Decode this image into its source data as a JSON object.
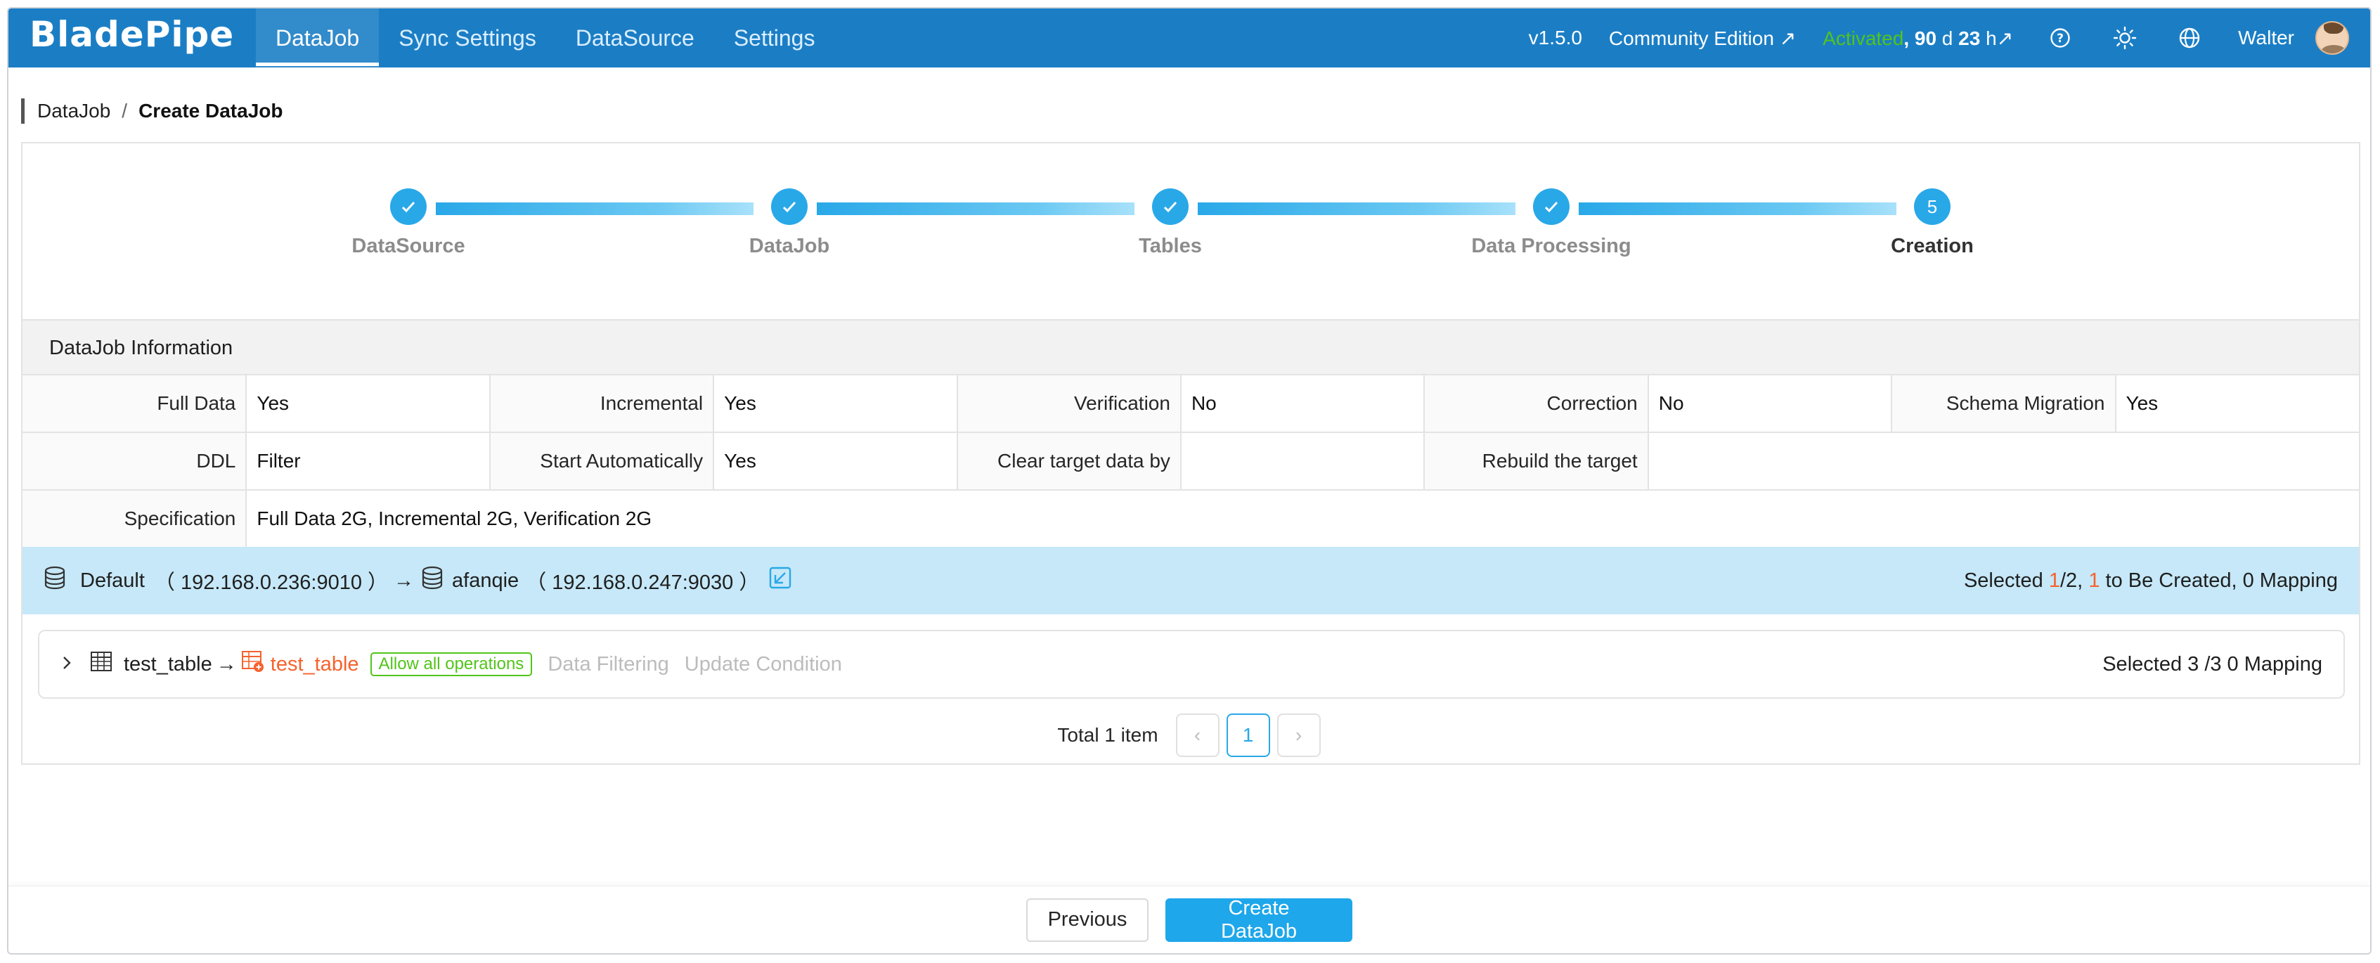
{
  "app": {
    "logo_text": "BladePipe"
  },
  "nav": {
    "items": [
      {
        "label": "DataJob",
        "active": true
      },
      {
        "label": "Sync Settings",
        "active": false
      },
      {
        "label": "DataSource",
        "active": false
      },
      {
        "label": "Settings",
        "active": false
      }
    ],
    "version": "v1.5.0",
    "edition": "Community Edition ↗",
    "activated": "Activated",
    "remaining_days": ", 90",
    "days_unit": "d",
    "remaining_hours": "23",
    "hours_unit": "h↗",
    "user": "Walter"
  },
  "breadcrumb": {
    "root": "DataJob",
    "sep": "/",
    "current": "Create DataJob"
  },
  "steps": [
    {
      "label": "DataSource",
      "done": true,
      "num": ""
    },
    {
      "label": "DataJob",
      "done": true,
      "num": ""
    },
    {
      "label": "Tables",
      "done": true,
      "num": ""
    },
    {
      "label": "Data Processing",
      "done": true,
      "num": ""
    },
    {
      "label": "Creation",
      "done": false,
      "num": "5"
    }
  ],
  "info": {
    "title": "DataJob Information",
    "full_data_k": "Full Data",
    "full_data_v": "Yes",
    "incremental_k": "Incremental",
    "incremental_v": "Yes",
    "verification_k": "Verification",
    "verification_v": "No",
    "correction_k": "Correction",
    "correction_v": "No",
    "schema_k": "Schema Migration",
    "schema_v": "Yes",
    "ddl_k": "DDL",
    "ddl_v": "Filter",
    "start_k": "Start Automatically",
    "start_v": "Yes",
    "clear_k": "Clear target data by",
    "clear_v": "",
    "rebuild_k": "Rebuild the target",
    "rebuild_v": "",
    "spec_k": "Specification",
    "spec_v": "Full Data 2G, Incremental 2G, Verification 2G"
  },
  "mapping": {
    "source_name": "Default",
    "source_host": "（ 192.168.0.236:9010 ）",
    "arrow": "→",
    "target_name": "afanqie",
    "target_host": "（ 192.168.0.247:9030 ）",
    "summary_prefix": "Selected",
    "selected": "1",
    "total": "/2,",
    "to_create": "1",
    "summary_suffix": "to Be Created, 0 Mapping"
  },
  "table_row": {
    "source_table": "test_table",
    "arrow": "→",
    "target_table": "test_table",
    "tag": "Allow all operations",
    "filter_link": "Data Filtering",
    "update_link": "Update Condition",
    "summary": "Selected 3 /3 0 Mapping"
  },
  "pager": {
    "total": "Total 1 item",
    "current_page": "1",
    "prev": "‹",
    "next": "›"
  },
  "footer": {
    "previous": "Previous",
    "create": "Create DataJob"
  },
  "colors": {
    "nav_bg": "#1b7ec5",
    "accent": "#29a8e8",
    "activated": "#52c41a",
    "highlight": "#f5622d"
  }
}
